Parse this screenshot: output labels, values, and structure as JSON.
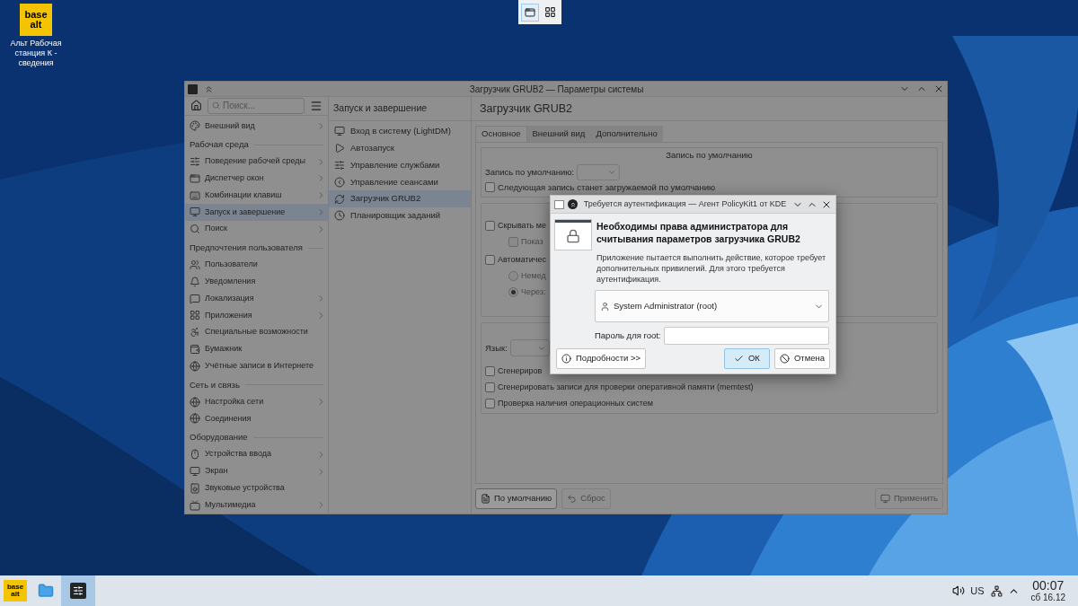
{
  "desktop_icons": [
    {
      "logo": [
        "base",
        "alt"
      ],
      "label": "Альт Рабочая станция К - сведения"
    }
  ],
  "window": {
    "title": "Загрузчик GRUB2 — Параметры системы",
    "search": {
      "placeholder": "Поиск..."
    },
    "sidebar": [
      {
        "kind": "item",
        "label": "Внешний вид",
        "expandable": true,
        "selected": false
      },
      {
        "kind": "section",
        "label": "Рабочая среда"
      },
      {
        "kind": "item",
        "label": "Поведение рабочей среды",
        "expandable": true,
        "selected": false
      },
      {
        "kind": "item",
        "label": "Диспетчер окон",
        "expandable": true,
        "selected": false
      },
      {
        "kind": "item",
        "label": "Комбинации клавиш",
        "expandable": true,
        "selected": false
      },
      {
        "kind": "item",
        "label": "Запуск и завершение",
        "expandable": true,
        "selected": true
      },
      {
        "kind": "item",
        "label": "Поиск",
        "expandable": true,
        "selected": false
      },
      {
        "kind": "section",
        "label": "Предпочтения пользователя"
      },
      {
        "kind": "item",
        "label": "Пользователи",
        "expandable": false,
        "selected": false
      },
      {
        "kind": "item",
        "label": "Уведомления",
        "expandable": false,
        "selected": false
      },
      {
        "kind": "item",
        "label": "Локализация",
        "expandable": true,
        "selected": false
      },
      {
        "kind": "item",
        "label": "Приложения",
        "expandable": true,
        "selected": false
      },
      {
        "kind": "item",
        "label": "Специальные возможности",
        "expandable": false,
        "selected": false
      },
      {
        "kind": "item",
        "label": "Бумажник",
        "expandable": false,
        "selected": false
      },
      {
        "kind": "item",
        "label": "Учётные записи в Интернете",
        "expandable": false,
        "selected": false
      },
      {
        "kind": "section",
        "label": "Сеть и связь"
      },
      {
        "kind": "item",
        "label": "Настройка сети",
        "expandable": true,
        "selected": false
      },
      {
        "kind": "item",
        "label": "Соединения",
        "expandable": false,
        "selected": false
      },
      {
        "kind": "section",
        "label": "Оборудование"
      },
      {
        "kind": "item",
        "label": "Устройства ввода",
        "expandable": true,
        "selected": false
      },
      {
        "kind": "item",
        "label": "Экран",
        "expandable": true,
        "selected": false
      },
      {
        "kind": "item",
        "label": "Звуковые устройства",
        "expandable": false,
        "selected": false
      },
      {
        "kind": "item",
        "label": "Мультимедиа",
        "expandable": true,
        "selected": false
      }
    ],
    "category": {
      "title": "Запуск и завершение",
      "items": [
        {
          "label": "Вход в систему (LightDM)",
          "selected": false
        },
        {
          "label": "Автозапуск",
          "selected": false
        },
        {
          "label": "Управление службами",
          "selected": false
        },
        {
          "label": "Управление сеансами",
          "selected": false
        },
        {
          "label": "Загрузчик GRUB2",
          "selected": true
        },
        {
          "label": "Планировщик заданий",
          "selected": false
        }
      ]
    },
    "page": {
      "title": "Загрузчик GRUB2",
      "tabs": [
        {
          "label": "Основное",
          "selected": true
        },
        {
          "label": "Внешний вид",
          "selected": false
        },
        {
          "label": "Дополнительно",
          "selected": false
        }
      ],
      "default_group": {
        "heading": "Запись по умолчанию",
        "field_label": "Запись по умолчанию:",
        "checkbox": {
          "label": "Следующая запись станет загружаемой по умолчанию",
          "checked": false
        }
      },
      "menu_group": [
        {
          "kind": "checkbox",
          "label": "Скрывать ме",
          "checked": false,
          "disabled": false,
          "children": [
            {
              "kind": "checkbox",
              "label": "Показ",
              "checked": false,
              "disabled": true
            }
          ]
        },
        {
          "kind": "checkbox",
          "label": "Автоматичес",
          "checked": false,
          "disabled": false,
          "children": [
            {
              "kind": "radio",
              "label": "Немед",
              "selected": false,
              "disabled": true
            },
            {
              "kind": "radio",
              "label": "Через:",
              "selected": true,
              "disabled": true
            }
          ]
        }
      ],
      "language_group": {
        "field_label": "Язык:",
        "checkboxes": [
          {
            "label": "Сгенериров",
            "checked": false
          },
          {
            "label": "Сгенерировать записи для проверки оперативной памяти (memtest)",
            "checked": false
          },
          {
            "label": "Проверка наличия операционных систем",
            "checked": false
          }
        ]
      },
      "buttons": [
        {
          "label": "По умолчанию",
          "disabled": false
        },
        {
          "label": "Сброс",
          "disabled": true
        },
        {
          "label": "Применить",
          "disabled": true
        }
      ]
    }
  },
  "dialog": {
    "title": "Требуется аутентификация — Агент PolicyKit1 от KDE",
    "heading": "Необходимы права администратора для считывания параметров загрузчика GRUB2",
    "message": "Приложение пытается выполнить действие, которое требует дополнительных привилегий. Для этого требуется аутентификация.",
    "user": "System Administrator (root)",
    "password_label": "Пароль для root:",
    "buttons": [
      {
        "label": "Подробности >>",
        "default": false
      },
      {
        "label": "ОК",
        "default": true
      },
      {
        "label": "Отмена",
        "default": false
      }
    ]
  },
  "taskbar": {
    "launcher_logo": [
      "base",
      "alt"
    ],
    "tasks": [
      {
        "selected": false
      },
      {
        "selected": false
      },
      {
        "selected": true
      }
    ],
    "keyboard_layout": "US",
    "time": "00:07",
    "date": "сб 16.12"
  }
}
